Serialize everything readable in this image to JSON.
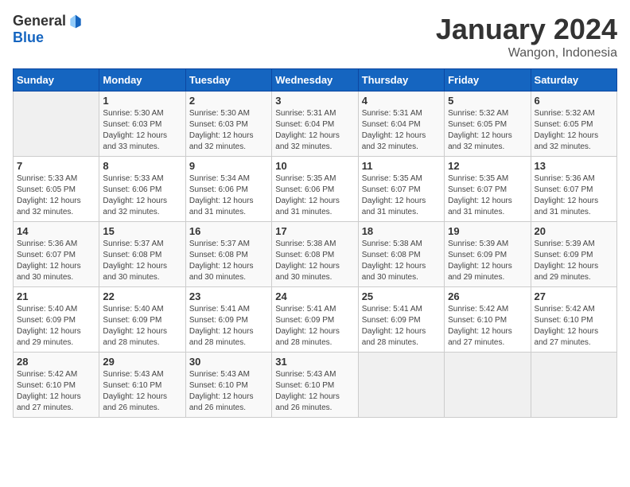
{
  "header": {
    "logo_general": "General",
    "logo_blue": "Blue",
    "month_title": "January 2024",
    "subtitle": "Wangon, Indonesia"
  },
  "days_of_week": [
    "Sunday",
    "Monday",
    "Tuesday",
    "Wednesday",
    "Thursday",
    "Friday",
    "Saturday"
  ],
  "weeks": [
    [
      {
        "day": "",
        "sunrise": "",
        "sunset": "",
        "daylight": ""
      },
      {
        "day": "1",
        "sunrise": "Sunrise: 5:30 AM",
        "sunset": "Sunset: 6:03 PM",
        "daylight": "Daylight: 12 hours and 33 minutes."
      },
      {
        "day": "2",
        "sunrise": "Sunrise: 5:30 AM",
        "sunset": "Sunset: 6:03 PM",
        "daylight": "Daylight: 12 hours and 32 minutes."
      },
      {
        "day": "3",
        "sunrise": "Sunrise: 5:31 AM",
        "sunset": "Sunset: 6:04 PM",
        "daylight": "Daylight: 12 hours and 32 minutes."
      },
      {
        "day": "4",
        "sunrise": "Sunrise: 5:31 AM",
        "sunset": "Sunset: 6:04 PM",
        "daylight": "Daylight: 12 hours and 32 minutes."
      },
      {
        "day": "5",
        "sunrise": "Sunrise: 5:32 AM",
        "sunset": "Sunset: 6:05 PM",
        "daylight": "Daylight: 12 hours and 32 minutes."
      },
      {
        "day": "6",
        "sunrise": "Sunrise: 5:32 AM",
        "sunset": "Sunset: 6:05 PM",
        "daylight": "Daylight: 12 hours and 32 minutes."
      }
    ],
    [
      {
        "day": "7",
        "sunrise": "Sunrise: 5:33 AM",
        "sunset": "Sunset: 6:05 PM",
        "daylight": "Daylight: 12 hours and 32 minutes."
      },
      {
        "day": "8",
        "sunrise": "Sunrise: 5:33 AM",
        "sunset": "Sunset: 6:06 PM",
        "daylight": "Daylight: 12 hours and 32 minutes."
      },
      {
        "day": "9",
        "sunrise": "Sunrise: 5:34 AM",
        "sunset": "Sunset: 6:06 PM",
        "daylight": "Daylight: 12 hours and 31 minutes."
      },
      {
        "day": "10",
        "sunrise": "Sunrise: 5:35 AM",
        "sunset": "Sunset: 6:06 PM",
        "daylight": "Daylight: 12 hours and 31 minutes."
      },
      {
        "day": "11",
        "sunrise": "Sunrise: 5:35 AM",
        "sunset": "Sunset: 6:07 PM",
        "daylight": "Daylight: 12 hours and 31 minutes."
      },
      {
        "day": "12",
        "sunrise": "Sunrise: 5:35 AM",
        "sunset": "Sunset: 6:07 PM",
        "daylight": "Daylight: 12 hours and 31 minutes."
      },
      {
        "day": "13",
        "sunrise": "Sunrise: 5:36 AM",
        "sunset": "Sunset: 6:07 PM",
        "daylight": "Daylight: 12 hours and 31 minutes."
      }
    ],
    [
      {
        "day": "14",
        "sunrise": "Sunrise: 5:36 AM",
        "sunset": "Sunset: 6:07 PM",
        "daylight": "Daylight: 12 hours and 30 minutes."
      },
      {
        "day": "15",
        "sunrise": "Sunrise: 5:37 AM",
        "sunset": "Sunset: 6:08 PM",
        "daylight": "Daylight: 12 hours and 30 minutes."
      },
      {
        "day": "16",
        "sunrise": "Sunrise: 5:37 AM",
        "sunset": "Sunset: 6:08 PM",
        "daylight": "Daylight: 12 hours and 30 minutes."
      },
      {
        "day": "17",
        "sunrise": "Sunrise: 5:38 AM",
        "sunset": "Sunset: 6:08 PM",
        "daylight": "Daylight: 12 hours and 30 minutes."
      },
      {
        "day": "18",
        "sunrise": "Sunrise: 5:38 AM",
        "sunset": "Sunset: 6:08 PM",
        "daylight": "Daylight: 12 hours and 30 minutes."
      },
      {
        "day": "19",
        "sunrise": "Sunrise: 5:39 AM",
        "sunset": "Sunset: 6:09 PM",
        "daylight": "Daylight: 12 hours and 29 minutes."
      },
      {
        "day": "20",
        "sunrise": "Sunrise: 5:39 AM",
        "sunset": "Sunset: 6:09 PM",
        "daylight": "Daylight: 12 hours and 29 minutes."
      }
    ],
    [
      {
        "day": "21",
        "sunrise": "Sunrise: 5:40 AM",
        "sunset": "Sunset: 6:09 PM",
        "daylight": "Daylight: 12 hours and 29 minutes."
      },
      {
        "day": "22",
        "sunrise": "Sunrise: 5:40 AM",
        "sunset": "Sunset: 6:09 PM",
        "daylight": "Daylight: 12 hours and 28 minutes."
      },
      {
        "day": "23",
        "sunrise": "Sunrise: 5:41 AM",
        "sunset": "Sunset: 6:09 PM",
        "daylight": "Daylight: 12 hours and 28 minutes."
      },
      {
        "day": "24",
        "sunrise": "Sunrise: 5:41 AM",
        "sunset": "Sunset: 6:09 PM",
        "daylight": "Daylight: 12 hours and 28 minutes."
      },
      {
        "day": "25",
        "sunrise": "Sunrise: 5:41 AM",
        "sunset": "Sunset: 6:09 PM",
        "daylight": "Daylight: 12 hours and 28 minutes."
      },
      {
        "day": "26",
        "sunrise": "Sunrise: 5:42 AM",
        "sunset": "Sunset: 6:10 PM",
        "daylight": "Daylight: 12 hours and 27 minutes."
      },
      {
        "day": "27",
        "sunrise": "Sunrise: 5:42 AM",
        "sunset": "Sunset: 6:10 PM",
        "daylight": "Daylight: 12 hours and 27 minutes."
      }
    ],
    [
      {
        "day": "28",
        "sunrise": "Sunrise: 5:42 AM",
        "sunset": "Sunset: 6:10 PM",
        "daylight": "Daylight: 12 hours and 27 minutes."
      },
      {
        "day": "29",
        "sunrise": "Sunrise: 5:43 AM",
        "sunset": "Sunset: 6:10 PM",
        "daylight": "Daylight: 12 hours and 26 minutes."
      },
      {
        "day": "30",
        "sunrise": "Sunrise: 5:43 AM",
        "sunset": "Sunset: 6:10 PM",
        "daylight": "Daylight: 12 hours and 26 minutes."
      },
      {
        "day": "31",
        "sunrise": "Sunrise: 5:43 AM",
        "sunset": "Sunset: 6:10 PM",
        "daylight": "Daylight: 12 hours and 26 minutes."
      },
      {
        "day": "",
        "sunrise": "",
        "sunset": "",
        "daylight": ""
      },
      {
        "day": "",
        "sunrise": "",
        "sunset": "",
        "daylight": ""
      },
      {
        "day": "",
        "sunrise": "",
        "sunset": "",
        "daylight": ""
      }
    ]
  ]
}
